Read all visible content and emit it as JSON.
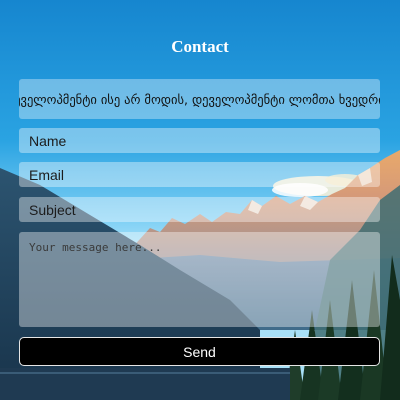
{
  "header": {
    "title": "Contact"
  },
  "quote": {
    "text": "დეველოპმენტი ისე არ მოდის, დეველოპმენტი ლომთა ხვედრია."
  },
  "form": {
    "name_placeholder": "Name",
    "email_placeholder": "Email",
    "subject_placeholder": "Subject",
    "message_placeholder": "Your message here...",
    "send_label": "Send"
  },
  "colors": {
    "sky_top": "#1b8fd6",
    "sky_bottom": "#8ad6f6",
    "button_bg": "#000000",
    "button_text": "#ffffff"
  }
}
